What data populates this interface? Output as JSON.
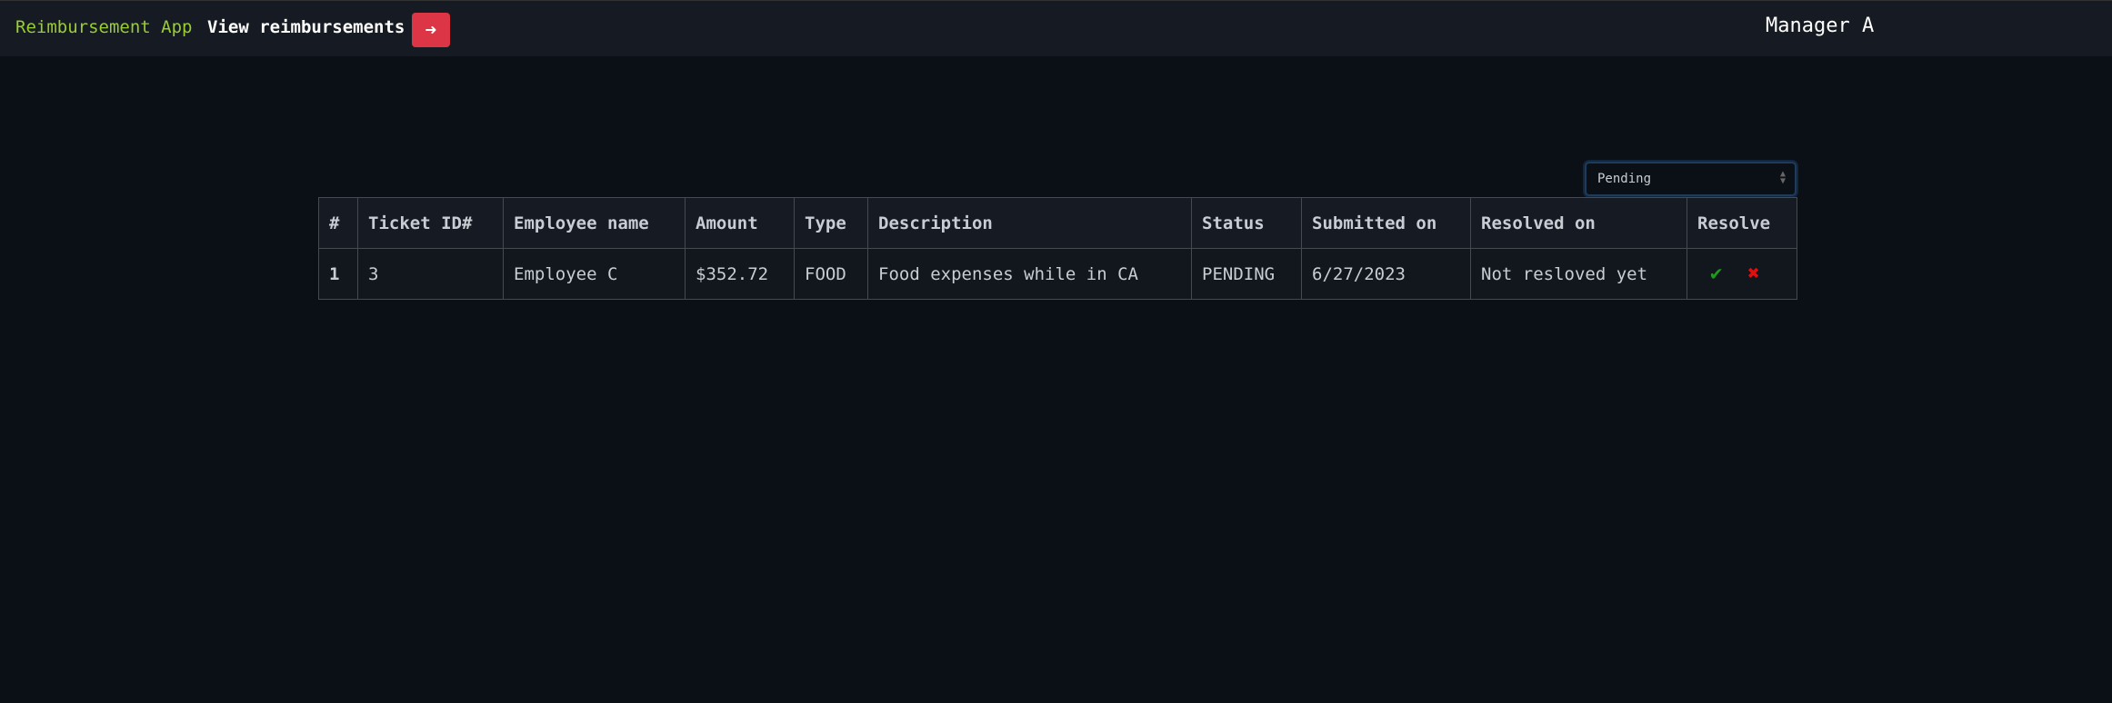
{
  "nav": {
    "brand": "Reimbursement App",
    "link": "View reimbursements",
    "logout_icon": "sign-out-icon",
    "user": "Manager A"
  },
  "filter": {
    "selected": "Pending"
  },
  "table": {
    "headers": [
      "#",
      "Ticket ID#",
      "Employee name",
      "Amount",
      "Type",
      "Description",
      "Status",
      "Submitted on",
      "Resolved on",
      "Resolve"
    ],
    "rows": [
      {
        "idx": "1",
        "ticket": "3",
        "employee": "Employee C",
        "amount": "$352.72",
        "type": "FOOD",
        "description": "Food expenses while in CA",
        "status": "PENDING",
        "submitted": "6/27/2023",
        "resolved": "Not resloved yet"
      }
    ]
  },
  "colors": {
    "approve": "#1a9e1a",
    "deny": "#e01010",
    "brand": "#9acd32",
    "logout": "#dc3545"
  }
}
